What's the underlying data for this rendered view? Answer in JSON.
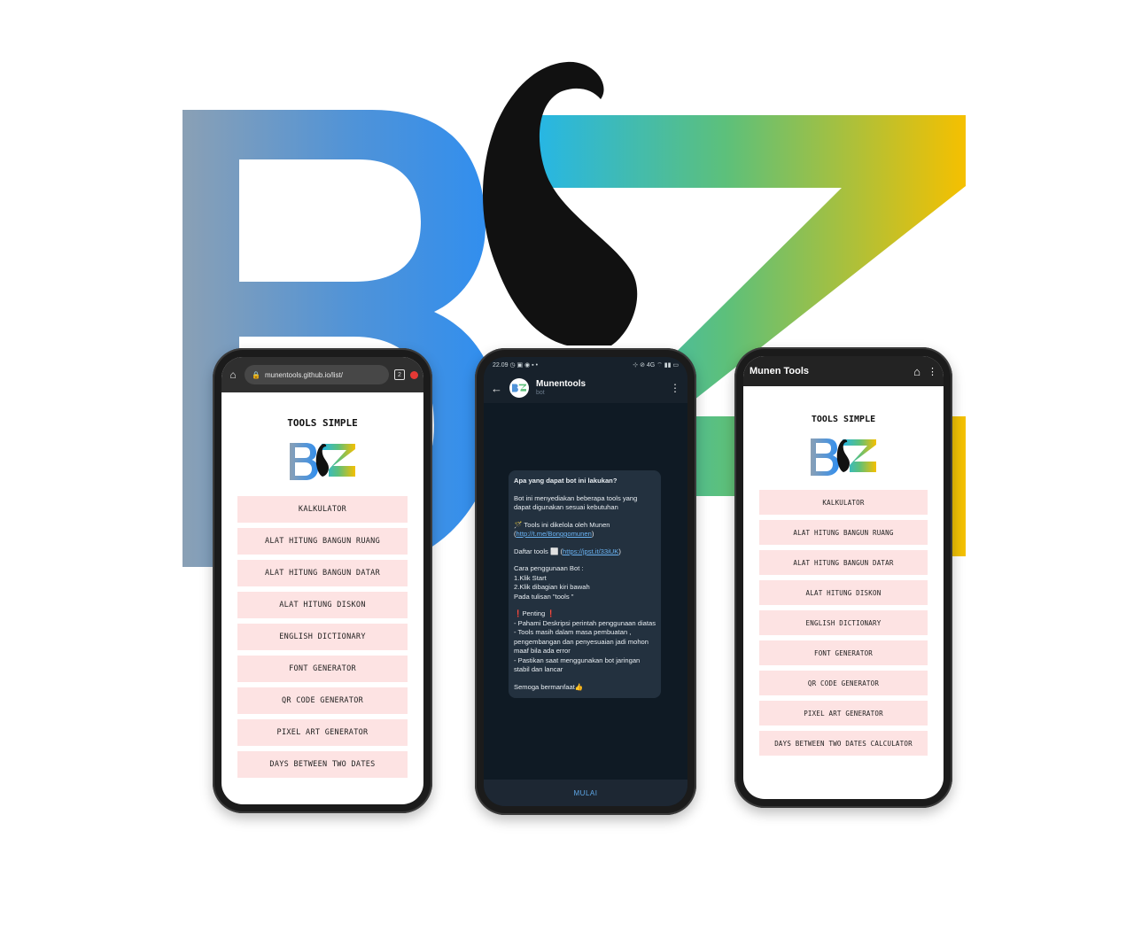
{
  "left_phone": {
    "url": "munentools.github.io/list/",
    "tab_count": "2",
    "page_title": "TOOLS SIMPLE",
    "menu": [
      "KALKULATOR",
      "ALAT HITUNG BANGUN RUANG",
      "ALAT HITUNG BANGUN DATAR",
      "ALAT HITUNG DISKON",
      "ENGLISH DICTIONARY",
      "FONT GENERATOR",
      "QR CODE GENERATOR",
      "PIXEL ART GENERATOR",
      "DAYS BETWEEN TWO DATES"
    ]
  },
  "middle_phone": {
    "status_time": "22.09",
    "status_icons": "◷ ▣ ◉ ▪ •",
    "status_right": "⊹ ⊘ 4G ⌔ ▮▮ ▭",
    "chat_name": "Munentools",
    "chat_sub": "bot",
    "message": {
      "title": "Apa yang dapat bot ini lakukan?",
      "intro": "Bot ini menyediakan  beberapa tools yang dapat digunakan sesuai kebutuhan",
      "managed": "🪄 Tools ini dikelola oleh Munen",
      "managed_link": "http://t.me/Bonggomunen",
      "list_label": "Daftar tools ⬜",
      "list_link": "https://jpst.it/33iUK",
      "usage": [
        "Cara penggunaan Bot :",
        "1.Klik Start",
        "2.Klik dibagian kiri bawah",
        "Pada tulisan \"tools \""
      ],
      "important_title": "❗Penting ❗",
      "important": [
        "- Pahami Deskripsi perintah penggunaan diatas",
        "- Tools masih dalam masa pembuatan , pengembangan dan penyesuaian jadi mohon maaf bila ada error",
        "- Pastikan saat menggunakan bot jaringan stabil dan lancar"
      ],
      "closing": "Semoga bermanfaat👍"
    },
    "start_button": "MULAI"
  },
  "right_phone": {
    "app_title": "Munen Tools",
    "page_title": "TOOLS SIMPLE",
    "menu": [
      "KALKULATOR",
      "ALAT HITUNG BANGUN RUANG",
      "ALAT HITUNG BANGUN DATAR",
      "ALAT HITUNG DISKON",
      "ENGLISH DICTIONARY",
      "FONT GENERATOR",
      "QR CODE GENERATOR",
      "PIXEL ART GENERATOR",
      "DAYS BETWEEN TWO DATES CALCULATOR"
    ]
  },
  "icons": {
    "home": "home-icon",
    "lock": "lock-icon",
    "back": "back-arrow-icon",
    "more": "more-vert-icon"
  }
}
